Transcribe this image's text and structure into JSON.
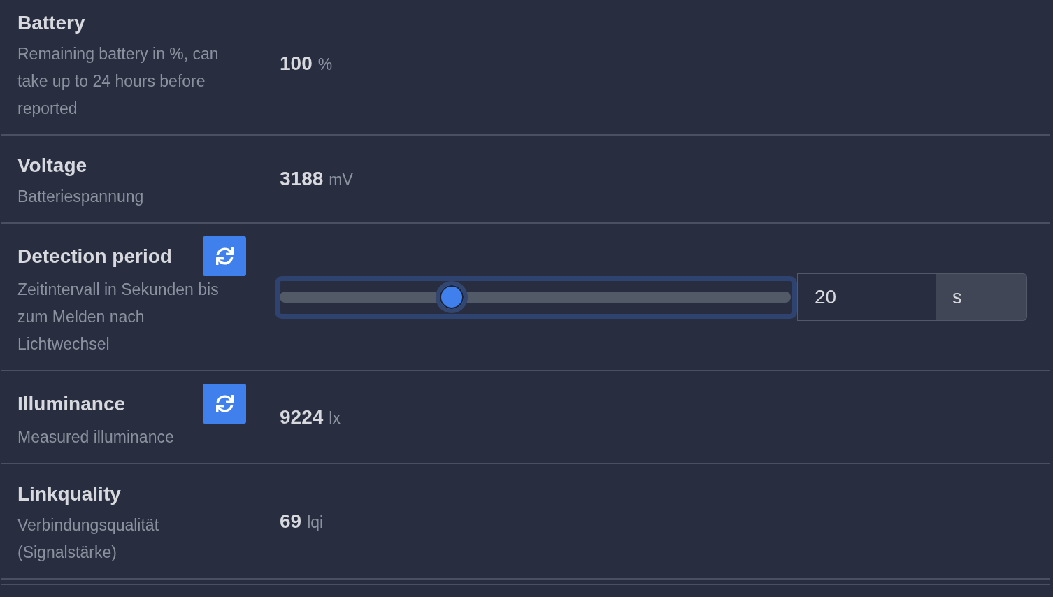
{
  "rows": [
    {
      "kind": "reading",
      "title": "Battery",
      "refresh_button": false,
      "description": "Remaining battery in %, can take up to 24 hours before reported",
      "value": "100",
      "unit": "%"
    },
    {
      "kind": "reading",
      "title": "Voltage",
      "refresh_button": false,
      "description": "Batteriespannung",
      "value": "3188",
      "unit": "mV"
    },
    {
      "kind": "slider",
      "title": "Detection period",
      "refresh_button": true,
      "description": "Zeitintervall in Sekunden bis zum Melden nach Lichtwechsel",
      "focused": true,
      "level": 0.336,
      "value": "20",
      "unit": "s"
    },
    {
      "kind": "reading",
      "title": "Illuminance",
      "refresh_button": true,
      "description": "Measured illuminance",
      "value": "9224",
      "unit": "lx"
    },
    {
      "kind": "reading",
      "title": "Linkquality",
      "refresh_button": false,
      "description": "Verbindungsqualität (Signalstärke)",
      "value": "69",
      "unit": "lqi"
    }
  ]
}
